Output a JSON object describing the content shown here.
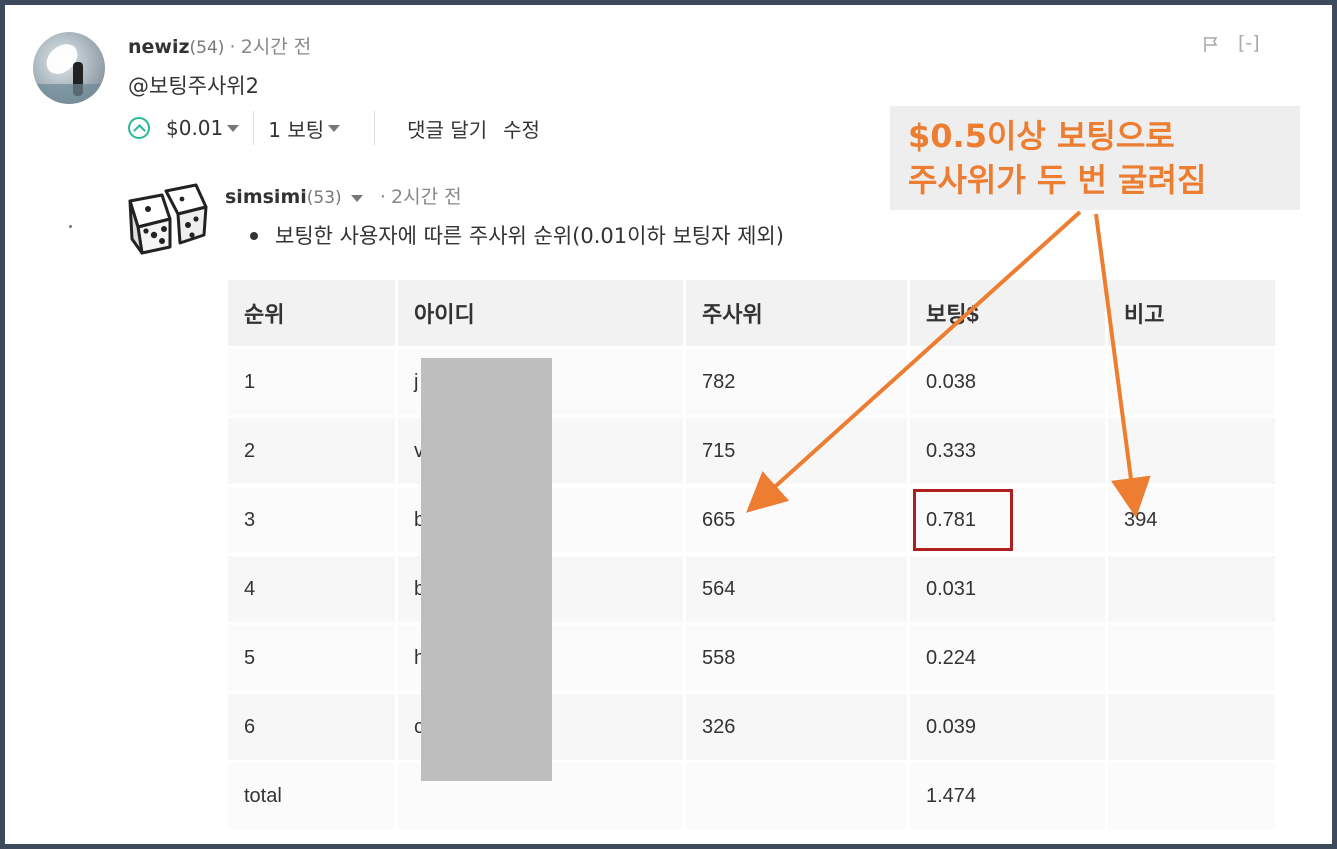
{
  "comment": {
    "author": "newiz",
    "reputation": "(54)",
    "separator": "·",
    "time": "2시간 전",
    "body": "@보팅주사위2",
    "payout": "$0.01",
    "votes": "1 보팅",
    "reply": "댓글 달기",
    "edit": "수정",
    "collapse": "[-]",
    "flag_icon": "flag-icon"
  },
  "reply": {
    "author": "simsimi",
    "reputation": "(53)",
    "separator": "·",
    "time": "2시간 전",
    "bullet_text": "보팅한 사용자에 따른 주사위 순위(0.01이하 보팅자 제외)"
  },
  "table": {
    "headers": [
      "순위",
      "아이디",
      "주사위",
      "보팅$",
      "비고"
    ],
    "rows": [
      {
        "rank": "1",
        "id": "j",
        "dice": "782",
        "vote": "0.038",
        "note": ""
      },
      {
        "rank": "2",
        "id": "v",
        "dice": "715",
        "vote": "0.333",
        "note": ""
      },
      {
        "rank": "3",
        "id": "b",
        "dice": "665",
        "vote": "0.781",
        "note": "394"
      },
      {
        "rank": "4",
        "id": "b",
        "dice": "564",
        "vote": "0.031",
        "note": ""
      },
      {
        "rank": "5",
        "id": "h",
        "dice": "558",
        "vote": "0.224",
        "note": ""
      },
      {
        "rank": "6",
        "id": "c",
        "dice": "326",
        "vote": "0.039",
        "note": ""
      },
      {
        "rank": "total",
        "id": "",
        "dice": "",
        "vote": "1.474",
        "note": ""
      }
    ]
  },
  "annotation": {
    "line1": "$0.5이상 보팅으로",
    "line2": "주사위가 두 번 굴려짐",
    "color": "#ed7d31",
    "box_color": "#b01e1e"
  }
}
